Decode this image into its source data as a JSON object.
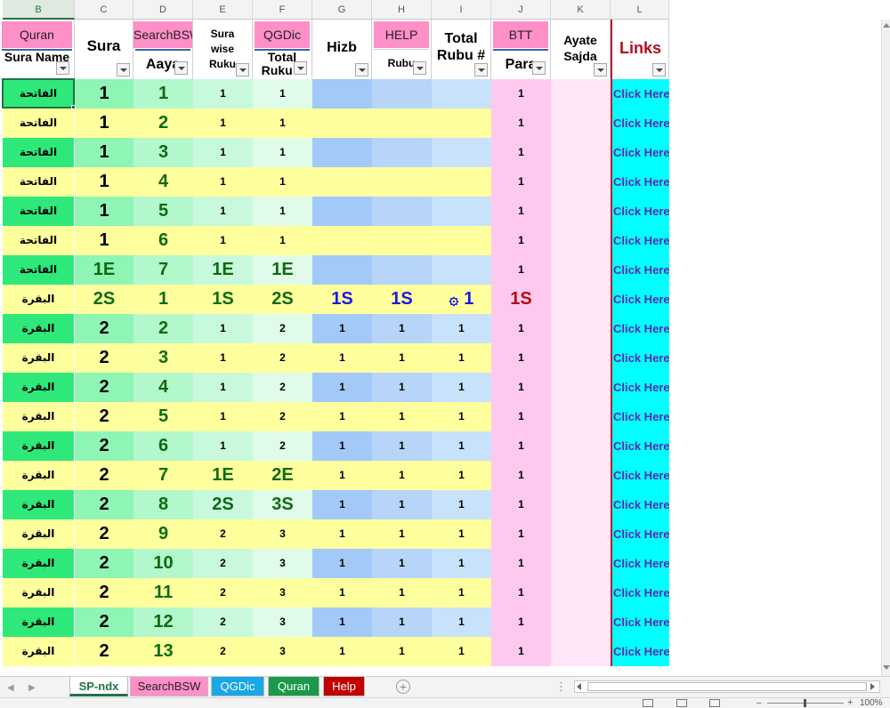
{
  "columns": [
    "B",
    "C",
    "D",
    "E",
    "F",
    "G",
    "H",
    "I",
    "J",
    "K",
    "L"
  ],
  "header": {
    "quran_tag": "Quran",
    "sura_name": "Sura Name",
    "sura": "Sura",
    "searchbsw_tag": "SearchBSW",
    "aaya": "Aaya",
    "sura_wise_ruku": "Sura wise Ruku",
    "qgdic_tag": "QGDic",
    "total_ruku": "Total Ruku #",
    "hizb": "Hizb",
    "help_tag": "HELP",
    "rubu": "Rubu",
    "total_rubu": "Total Rubu #",
    "btt_tag": "BTT",
    "para": "Para",
    "ayate_sajda": "Ayate Sajda",
    "links": "Links"
  },
  "colors": {
    "b_green": "#2ee87a",
    "c_green": "#8ff5b5",
    "d_green": "#b3f7cd",
    "e_green": "#c9f9dc",
    "f_green": "#e0fbea",
    "g_blue": "#a2c9f7",
    "h_blue": "#b6d5f8",
    "i_blue": "#c9e2fb",
    "j_pink": "#ffc9ef",
    "k_pink": "#fde6f8",
    "yellow": "#ffff9d",
    "link_cyan": "#00ffff"
  },
  "rows": [
    {
      "name": "الفاتحة",
      "sura": "1",
      "aaya": "1",
      "ruku": "1",
      "truku": "1",
      "hizb": "",
      "rubu": "",
      "trubu": "",
      "para": "1",
      "link": "Click Here"
    },
    {
      "name": "الفاتحة",
      "sura": "1",
      "aaya": "2",
      "ruku": "1",
      "truku": "1",
      "hizb": "",
      "rubu": "",
      "trubu": "",
      "para": "1",
      "link": "Click Here"
    },
    {
      "name": "الفاتحة",
      "sura": "1",
      "aaya": "3",
      "ruku": "1",
      "truku": "1",
      "hizb": "",
      "rubu": "",
      "trubu": "",
      "para": "1",
      "link": "Click Here"
    },
    {
      "name": "الفاتحة",
      "sura": "1",
      "aaya": "4",
      "ruku": "1",
      "truku": "1",
      "hizb": "",
      "rubu": "",
      "trubu": "",
      "para": "1",
      "link": "Click Here"
    },
    {
      "name": "الفاتحة",
      "sura": "1",
      "aaya": "5",
      "ruku": "1",
      "truku": "1",
      "hizb": "",
      "rubu": "",
      "trubu": "",
      "para": "1",
      "link": "Click Here"
    },
    {
      "name": "الفاتحة",
      "sura": "1",
      "aaya": "6",
      "ruku": "1",
      "truku": "1",
      "hizb": "",
      "rubu": "",
      "trubu": "",
      "para": "1",
      "link": "Click Here"
    },
    {
      "name": "الفاتحة",
      "sura": "1E",
      "aaya": "7",
      "ruku": "1E",
      "truku": "1E",
      "hizb": "",
      "rubu": "",
      "trubu": "",
      "para": "1",
      "link": "Click Here"
    },
    {
      "name": "البقرة",
      "sura": "2S",
      "aaya": "1",
      "ruku": "1S",
      "truku": "2S",
      "hizb": "1S",
      "rubu": "1S",
      "trubu": "1",
      "para": "1S",
      "link": "Click Here"
    },
    {
      "name": "البقرة",
      "sura": "2",
      "aaya": "2",
      "ruku": "1",
      "truku": "2",
      "hizb": "1",
      "rubu": "1",
      "trubu": "1",
      "para": "1",
      "link": "Click Here"
    },
    {
      "name": "البقرة",
      "sura": "2",
      "aaya": "3",
      "ruku": "1",
      "truku": "2",
      "hizb": "1",
      "rubu": "1",
      "trubu": "1",
      "para": "1",
      "link": "Click Here"
    },
    {
      "name": "البقرة",
      "sura": "2",
      "aaya": "4",
      "ruku": "1",
      "truku": "2",
      "hizb": "1",
      "rubu": "1",
      "trubu": "1",
      "para": "1",
      "link": "Click Here"
    },
    {
      "name": "البقرة",
      "sura": "2",
      "aaya": "5",
      "ruku": "1",
      "truku": "2",
      "hizb": "1",
      "rubu": "1",
      "trubu": "1",
      "para": "1",
      "link": "Click Here"
    },
    {
      "name": "البقرة",
      "sura": "2",
      "aaya": "6",
      "ruku": "1",
      "truku": "2",
      "hizb": "1",
      "rubu": "1",
      "trubu": "1",
      "para": "1",
      "link": "Click Here"
    },
    {
      "name": "البقرة",
      "sura": "2",
      "aaya": "7",
      "ruku": "1E",
      "truku": "2E",
      "hizb": "1",
      "rubu": "1",
      "trubu": "1",
      "para": "1",
      "link": "Click Here"
    },
    {
      "name": "البقرة",
      "sura": "2",
      "aaya": "8",
      "ruku": "2S",
      "truku": "3S",
      "hizb": "1",
      "rubu": "1",
      "trubu": "1",
      "para": "1",
      "link": "Click Here"
    },
    {
      "name": "البقرة",
      "sura": "2",
      "aaya": "9",
      "ruku": "2",
      "truku": "3",
      "hizb": "1",
      "rubu": "1",
      "trubu": "1",
      "para": "1",
      "link": "Click Here"
    },
    {
      "name": "البقرة",
      "sura": "2",
      "aaya": "10",
      "ruku": "2",
      "truku": "3",
      "hizb": "1",
      "rubu": "1",
      "trubu": "1",
      "para": "1",
      "link": "Click Here"
    },
    {
      "name": "البقرة",
      "sura": "2",
      "aaya": "11",
      "ruku": "2",
      "truku": "3",
      "hizb": "1",
      "rubu": "1",
      "trubu": "1",
      "para": "1",
      "link": "Click Here"
    },
    {
      "name": "البقرة",
      "sura": "2",
      "aaya": "12",
      "ruku": "2",
      "truku": "3",
      "hizb": "1",
      "rubu": "1",
      "trubu": "1",
      "para": "1",
      "link": "Click Here"
    },
    {
      "name": "البقرة",
      "sura": "2",
      "aaya": "13",
      "ruku": "2",
      "truku": "3",
      "hizb": "1",
      "rubu": "1",
      "trubu": "1",
      "para": "1",
      "link": "Click Here"
    }
  ],
  "tabs": [
    "SP-ndx",
    "SearchBSW",
    "QGDic",
    "Quran",
    "Help"
  ],
  "status": {
    "zoom": "100%"
  }
}
